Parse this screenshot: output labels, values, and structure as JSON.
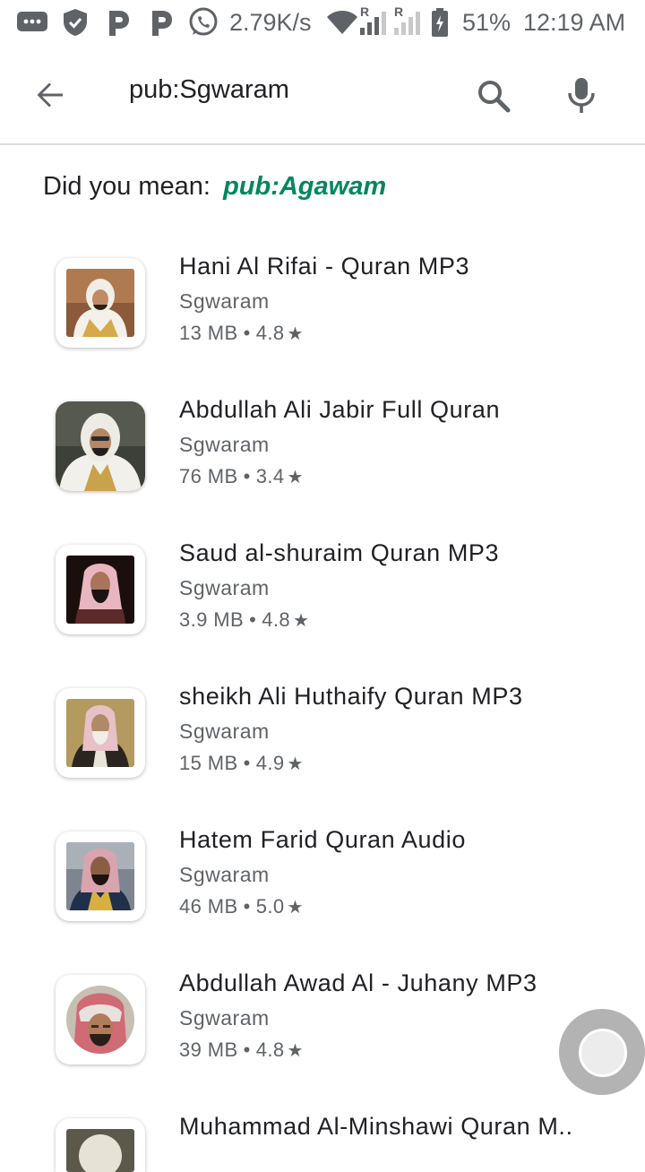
{
  "status_bar": {
    "net_speed": "2.79K/s",
    "roaming_1": "R",
    "roaming_2": "R",
    "battery": "51%",
    "time": "12:19 AM",
    "icons": [
      "sms-icon",
      "shield-icon",
      "p-app-icon",
      "p-app-icon",
      "whatsapp-icon",
      "wifi-icon",
      "signal-icon",
      "signal-icon",
      "battery-icon"
    ]
  },
  "search": {
    "query": "pub:Sgwaram",
    "back_icon": "back-arrow-icon",
    "search_icon": "search-icon",
    "mic_icon": "mic-icon"
  },
  "did_you_mean": {
    "prefix": "Did you mean:",
    "suggestion": "pub:Agawam"
  },
  "apps": [
    {
      "title": "Hani Al Rifai - Quran MP3",
      "developer": "Sgwaram",
      "size": "13 MB",
      "rating": "4.8"
    },
    {
      "title": "Abdullah Ali Jabir Full Quran",
      "developer": "Sgwaram",
      "size": "76 MB",
      "rating": "3.4"
    },
    {
      "title": "Saud al-shuraim Quran MP3",
      "developer": "Sgwaram",
      "size": "3.9 MB",
      "rating": "4.8"
    },
    {
      "title": "sheikh Ali Huthaify Quran MP3",
      "developer": "Sgwaram",
      "size": "15 MB",
      "rating": "4.9"
    },
    {
      "title": "Hatem Farid Quran Audio",
      "developer": "Sgwaram",
      "size": "46 MB",
      "rating": "5.0"
    },
    {
      "title": "Abdullah Awad Al - Juhany MP3",
      "developer": "Sgwaram",
      "size": "39 MB",
      "rating": "4.8"
    },
    {
      "title": "Muhammad Al-Minshawi Quran M..",
      "developer": "",
      "size": "",
      "rating": ""
    }
  ],
  "colors": {
    "accent_green": "#01875f",
    "text_primary": "#202124",
    "text_secondary": "#5f6368"
  }
}
